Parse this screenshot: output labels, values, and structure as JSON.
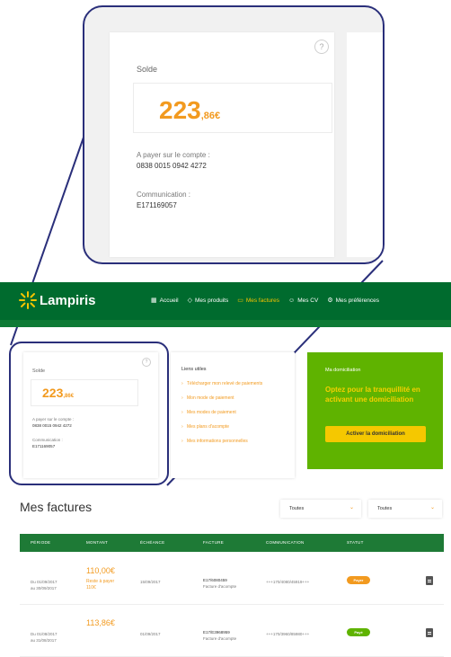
{
  "zoom": {
    "solde_label": "Solde",
    "amount_big": "223",
    "amount_small": ",86€",
    "help": "?",
    "pay_label": "A payer sur le compte :",
    "account": "0838 0015 0942 4272",
    "comm_label": "Communication :",
    "comm_value": "E171169057"
  },
  "header": {
    "brand": "Lampiris",
    "nav": [
      {
        "label": "Accueil",
        "icon": "▦"
      },
      {
        "label": "Mes produits",
        "icon": "◇"
      },
      {
        "label": "Mes factures",
        "icon": "▭"
      },
      {
        "label": "Mes CV",
        "icon": "☺"
      },
      {
        "label": "Mes préférences",
        "icon": "⚙"
      }
    ]
  },
  "solde": {
    "label": "Solde",
    "help": "?",
    "amount_big": "223",
    "amount_small": ",86€",
    "pay_label": "A payer sur le compte :",
    "account": "0838 0015 0942 4272",
    "comm_label": "Communication :",
    "comm_value": "E171169057"
  },
  "liens": {
    "title": "Liens utiles",
    "items": [
      "Télécharger mon relevé de paiements",
      "Mon mode de paiement",
      "Mes modes de paiement",
      "Mes plans d'acompte",
      "Mes informations personnelles"
    ]
  },
  "domiciliation": {
    "title": "Ma domiciliation",
    "headline": "Optez pour la tranquillité en activant une domiciliation",
    "button": "Activer la domiciliation"
  },
  "factures": {
    "title": "Mes factures",
    "filters": [
      {
        "value": "Toutes"
      },
      {
        "value": "Toutes"
      }
    ],
    "columns": [
      "PÉRIODE",
      "MONTANT",
      "ÉCHÉANCE",
      "FACTURE",
      "COMMUNICATION",
      "STATUT"
    ],
    "rows": [
      {
        "period_from": "Du 01/09/2017",
        "period_to": "au 30/09/2017",
        "amount": "110,00€",
        "remain_label": "Reste à payer",
        "remain_value": "110€",
        "due": "15/09/2017",
        "invoice_no": "E17/6080459",
        "invoice_type": "Facture d'acompte",
        "communication": "+++170/4080/45919+++",
        "status": "Payer",
        "status_color": "#f29a1f"
      },
      {
        "period_from": "Du 01/08/2017",
        "period_to": "au 31/08/2017",
        "amount": "113,86€",
        "remain_label": "",
        "remain_value": "",
        "due": "01/09/2017",
        "invoice_no": "E17/E3968959",
        "invoice_type": "Facture d'acompte",
        "communication": "+++170/3960/85980+++",
        "status": "Payé",
        "status_color": "#5fb300"
      }
    ]
  }
}
